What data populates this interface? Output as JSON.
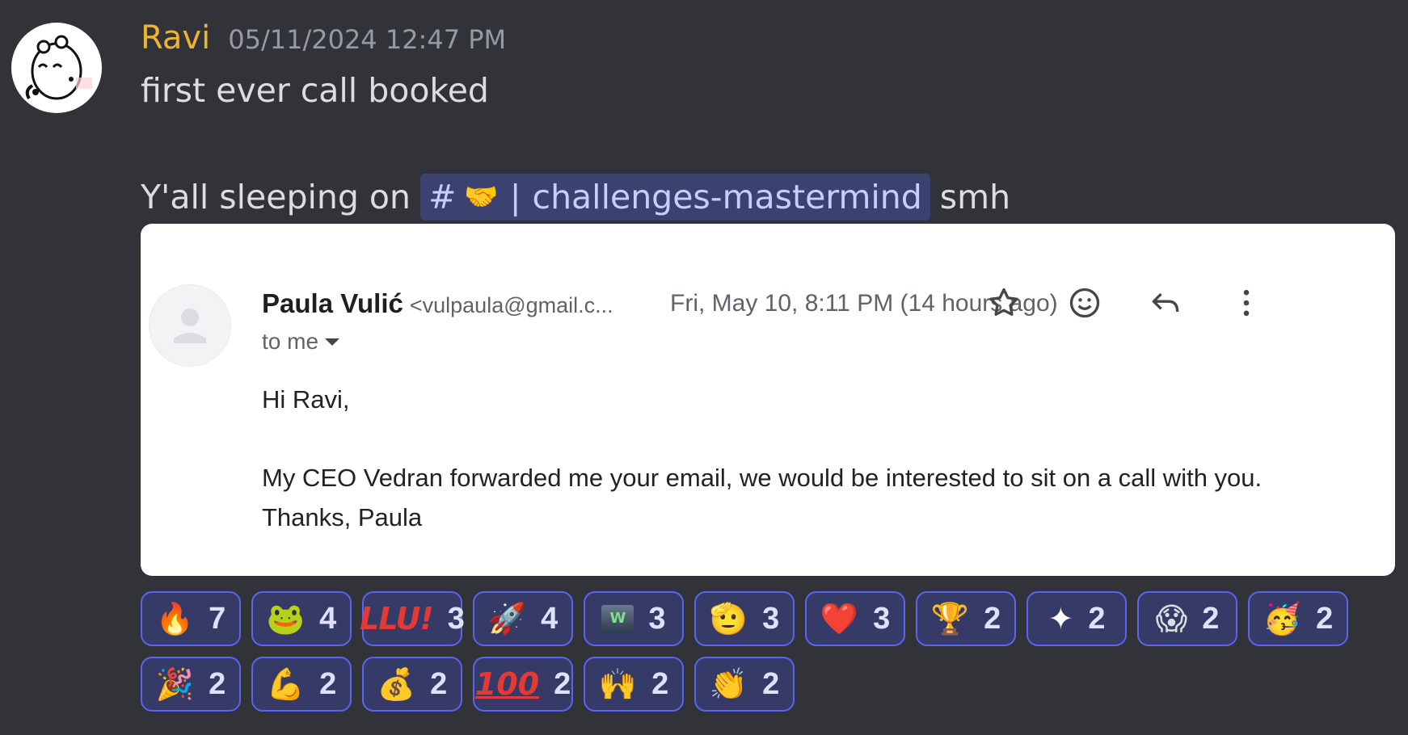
{
  "message": {
    "username": "Ravi",
    "timestamp": "05/11/2024 12:47 PM",
    "line1": "first ever call booked",
    "line2_before": "Y'all sleeping on",
    "channel": {
      "hash": "#",
      "emoji": "🤝",
      "separator": "|",
      "name": "challenges-mastermind"
    },
    "line2_after": "smh"
  },
  "email": {
    "sender_name": "Paula Vulić",
    "sender_email": "<vulpaula@gmail.c...",
    "date": "Fri, May 10, 8:11 PM (14 hours ago)",
    "to": "to me",
    "greeting": "Hi Ravi,",
    "body_line1": "My CEO Vedran forwarded me your email, we would be interested to sit on a call with you.",
    "body_line2": "Thanks, Paula"
  },
  "reactions": {
    "row1": [
      {
        "emoji": "🔥",
        "count": "7"
      },
      {
        "emoji": "🐸",
        "count": "4"
      },
      {
        "emoji": "LLU!",
        "count": "3"
      },
      {
        "emoji": "🚀",
        "count": "4"
      },
      {
        "emoji": "W",
        "count": "3"
      },
      {
        "emoji": "🫡",
        "count": "3"
      },
      {
        "emoji": "❤️",
        "count": "3"
      },
      {
        "emoji": "🏆",
        "count": "2"
      },
      {
        "emoji": "✦",
        "count": "2"
      },
      {
        "emoji": "😱",
        "count": "2"
      },
      {
        "emoji": "🥳",
        "count": "2"
      }
    ],
    "row2": [
      {
        "emoji": "🎉",
        "count": "2"
      },
      {
        "emoji": "💪",
        "count": "2"
      },
      {
        "emoji": "💰",
        "count": "2"
      },
      {
        "emoji": "100",
        "count": "2"
      },
      {
        "emoji": "🙌",
        "count": "2"
      },
      {
        "emoji": "👏",
        "count": "2"
      }
    ]
  },
  "colors": {
    "background": "#313338",
    "username": "#f0b232",
    "mention_bg": "#3c4270",
    "reaction_border": "#5865f2"
  }
}
